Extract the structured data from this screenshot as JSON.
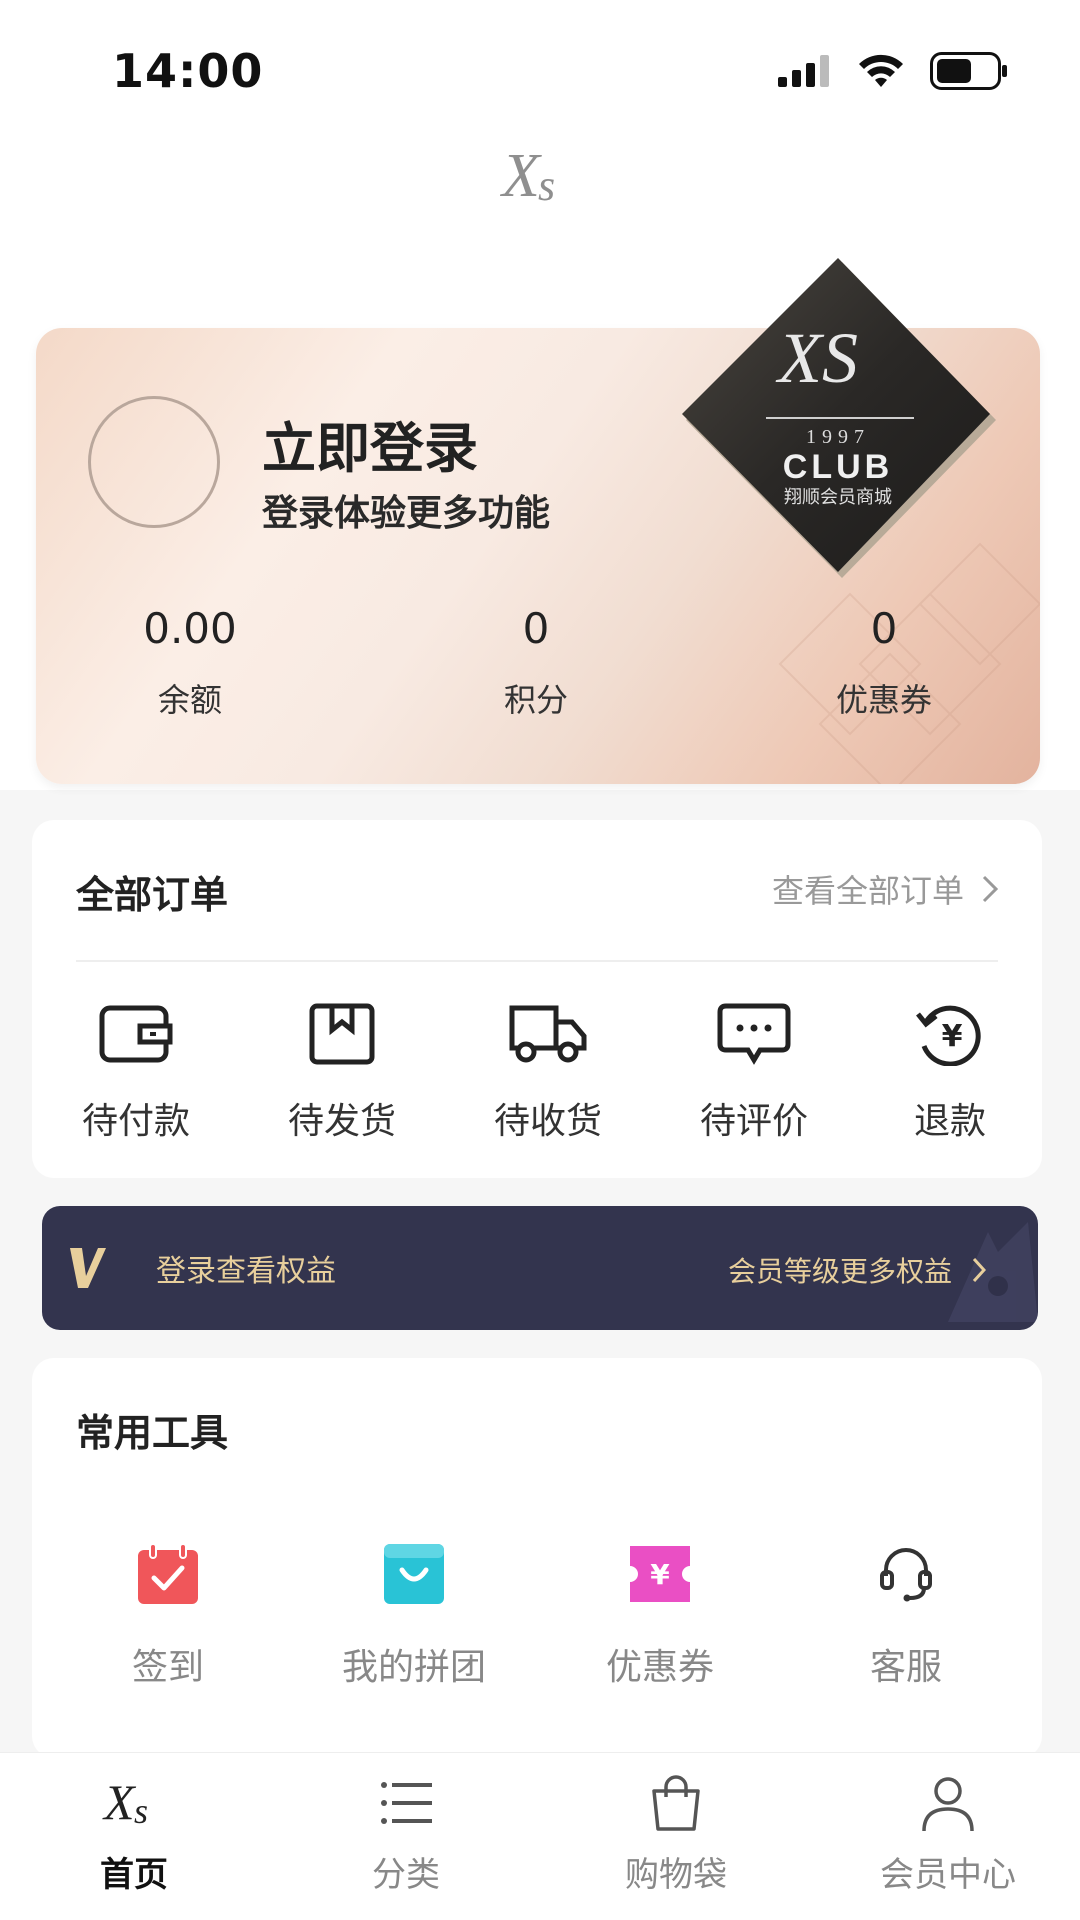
{
  "status_bar": {
    "time": "14:00",
    "icons": [
      "signal-icon",
      "wifi-icon",
      "battery-icon"
    ]
  },
  "app_logo": {
    "text": "XS"
  },
  "member_card": {
    "title": "立即登录",
    "subtitle": "登录体验更多功能",
    "badge": {
      "logo": "XS",
      "year": "1997",
      "name": "CLUB",
      "caption": "翔顺会员商城"
    },
    "stats": [
      {
        "value": "0.00",
        "label": "余额"
      },
      {
        "value": "0",
        "label": "积分"
      },
      {
        "value": "0",
        "label": "优惠券"
      }
    ]
  },
  "orders": {
    "title": "全部订单",
    "view_all": "查看全部订单",
    "items": [
      {
        "label": "待付款",
        "icon": "wallet-icon"
      },
      {
        "label": "待发货",
        "icon": "box-icon"
      },
      {
        "label": "待收货",
        "icon": "truck-icon"
      },
      {
        "label": "待评价",
        "icon": "comment-icon"
      },
      {
        "label": "退款",
        "icon": "refund-icon"
      }
    ]
  },
  "benefits": {
    "text": "登录查看权益",
    "link": "会员等级更多权益",
    "color": "#33344e",
    "text_color": "#e8cf9c"
  },
  "tools": {
    "title": "常用工具",
    "items": [
      {
        "label": "签到",
        "icon": "calendar-check-icon",
        "color": "#f0565a"
      },
      {
        "label": "我的拼团",
        "icon": "shopping-bag-icon",
        "color": "#29c3d6"
      },
      {
        "label": "优惠券",
        "icon": "yen-coupon-icon",
        "color": "#ea4fc4"
      },
      {
        "label": "客服",
        "icon": "headset-icon",
        "color": "#333333"
      }
    ]
  },
  "tab_bar": {
    "items": [
      {
        "label": "首页",
        "icon": "xs-logo-icon",
        "active": true
      },
      {
        "label": "分类",
        "icon": "list-icon",
        "active": false
      },
      {
        "label": "购物袋",
        "icon": "shopping-bag-outline-icon",
        "active": false
      },
      {
        "label": "会员中心",
        "icon": "person-icon",
        "active": false
      }
    ]
  }
}
